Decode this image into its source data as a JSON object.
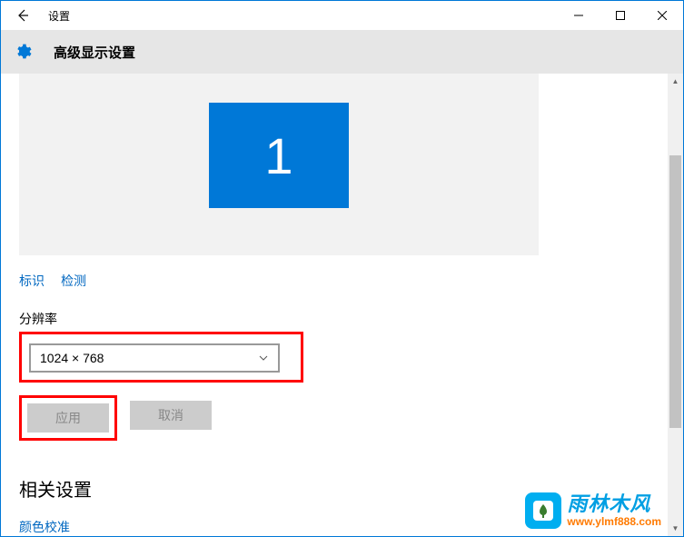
{
  "titlebar": {
    "app_name": "设置"
  },
  "header": {
    "page_title": "高级显示设置"
  },
  "display": {
    "monitor_number": "1"
  },
  "links": {
    "identify": "标识",
    "detect": "检测"
  },
  "resolution": {
    "label": "分辨率",
    "value": "1024 × 768"
  },
  "buttons": {
    "apply": "应用",
    "cancel": "取消"
  },
  "related": {
    "title": "相关设置",
    "color_calibration": "颜色校准"
  },
  "watermark": {
    "name": "雨林木风",
    "url": "www.ylmf888.com"
  }
}
